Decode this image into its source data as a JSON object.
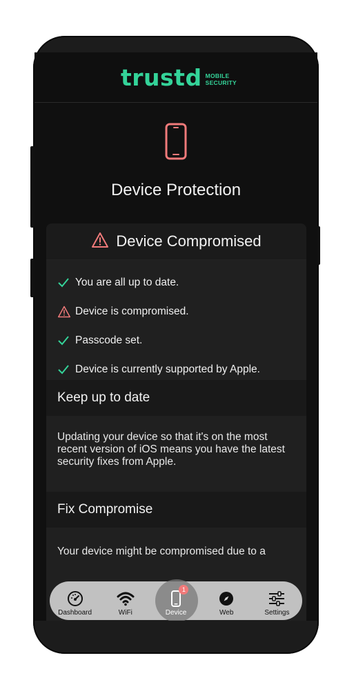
{
  "brand": {
    "wordmark": "trustd",
    "sub_line1": "MOBILE",
    "sub_line2": "SECURITY",
    "color": "#34d399"
  },
  "page": {
    "title": "Device Protection",
    "icon": "phone-icon",
    "icon_color": "#f07a7a"
  },
  "status_card": {
    "title": "Device Compromised",
    "title_icon": "warning-triangle-icon",
    "checks": [
      {
        "icon": "checkmark-icon",
        "status": "ok",
        "text": "You are all up to date."
      },
      {
        "icon": "warning-triangle-icon",
        "status": "warn",
        "text": "Device is compromised."
      },
      {
        "icon": "checkmark-icon",
        "status": "ok",
        "text": "Passcode set."
      },
      {
        "icon": "checkmark-icon",
        "status": "ok",
        "text": "Device is currently supported by Apple."
      }
    ]
  },
  "sections": [
    {
      "title": "Keep up to date",
      "body": "Updating your device so that it's on the most recent version of iOS means you have the latest security fixes from Apple."
    },
    {
      "title": "Fix Compromise",
      "body": "Your device might be compromised due to a"
    }
  ],
  "tabbar": {
    "tabs": [
      {
        "label": "Dashboard",
        "icon": "speedometer-icon"
      },
      {
        "label": "WiFi",
        "icon": "wifi-icon"
      },
      {
        "label": "Device",
        "icon": "phone-icon",
        "badge": "1",
        "active": true
      },
      {
        "label": "Web",
        "icon": "compass-icon"
      },
      {
        "label": "Settings",
        "icon": "sliders-icon"
      }
    ]
  },
  "colors": {
    "ok": "#34d399",
    "warn": "#f07a7a",
    "background": "#101010"
  }
}
